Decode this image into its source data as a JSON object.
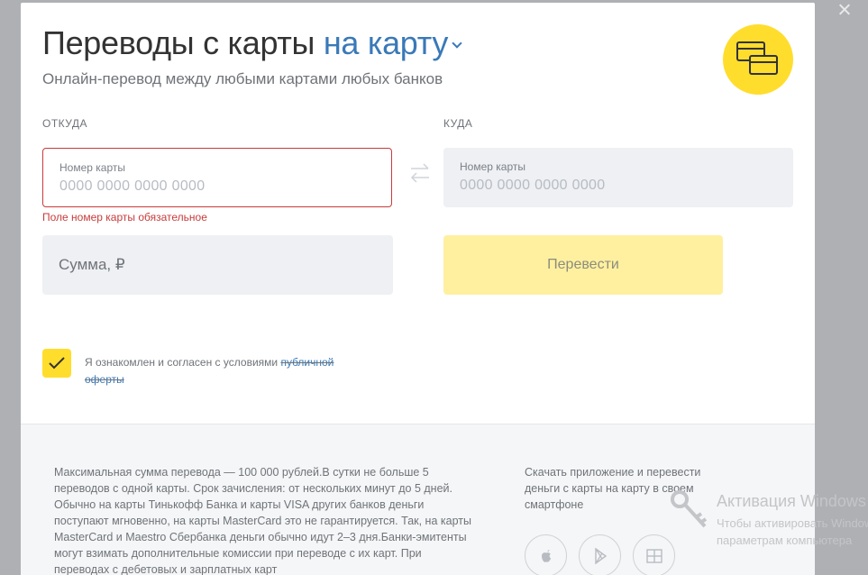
{
  "modal": {
    "title_main": "Переводы с карты",
    "title_accent": "на карту",
    "subtitle": "Онлайн-перевод между любыми картами любых банков",
    "badge_icon": "cards-icon",
    "accent_color": "#ffdd2d"
  },
  "form": {
    "from_label": "ОТКУДА",
    "to_label": "КУДА",
    "from_card": {
      "label": "Номер карты",
      "placeholder": "0000 0000 0000 0000"
    },
    "to_card": {
      "label": "Номер карты",
      "placeholder": "0000 0000 0000 0000"
    },
    "error_text": "Поле номер карты обязательное",
    "amount_placeholder": "Сумма, ₽",
    "submit_label": "Перевести",
    "agree_text": "Я ознакомлен и согласен с условиями",
    "agree_link": "публичной оферты",
    "error_color": "#c83b3b"
  },
  "footer": {
    "info": "Максимальная сумма перевода — 100 000 рублей.В сутки не больше 5 переводов с одной карты. Срок зачисления: от нескольких минут до 5 дней. Обычно на карты Тинькофф Банка и карты VISA других банков деньги поступают мгновенно, на карты MasterCard это не гарантируется. Так, на карты MasterCard и Maestro Сбербанка деньги обычно идут 2–3 дня.Банки-эмитенты могут взимать дополнительные комиссии при переводе с их карт. При переводах с дебетовых и зарплатных карт",
    "app_text": "Скачать приложение и перевести деньги с карты на карту в своем смартфоне",
    "stores": [
      "apple-icon",
      "google-play-icon",
      "windows-icon"
    ]
  },
  "watermark": {
    "line1": "Активация Windows",
    "line2": "Чтобы активировать Windows",
    "line3": "параметрам компьютера"
  }
}
